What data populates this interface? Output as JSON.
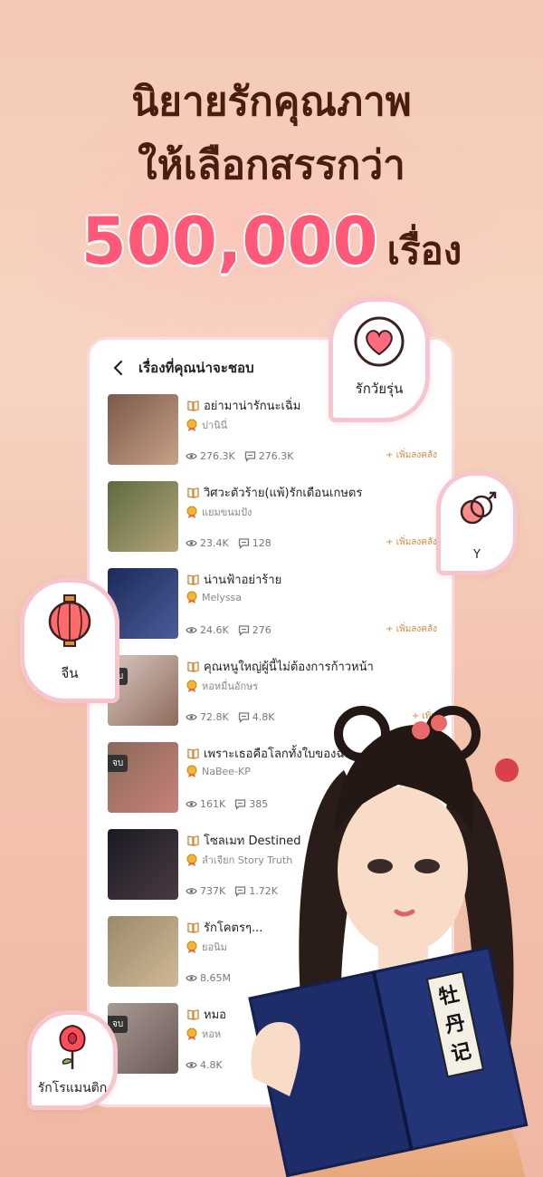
{
  "headline": {
    "line1": "นิยายรักคุณภาพ",
    "line2": "ให้เลือกสรรกว่า",
    "count": "500,000",
    "unit": "เรื่อง"
  },
  "screen": {
    "title": "เรื่องที่คุณน่าจะชอบ",
    "books": [
      {
        "title": "อย่ามาน่ารักนะเฉิ่ม",
        "author": "ปานินี่",
        "views": "276.3K",
        "comments": "276.3K",
        "add": "+ เพิ่มลงคลัง",
        "tag": "",
        "colors": [
          "#7a5a4a",
          "#c9a088"
        ]
      },
      {
        "title": "วิศวะตัวร้าย(แพ้)รักเดือนเกษตร",
        "author": "แยมขนมปัง",
        "views": "23.4K",
        "comments": "128",
        "add": "+ เพิ่มลงคลัง",
        "tag": "",
        "colors": [
          "#5d6b3e",
          "#b5a47a"
        ]
      },
      {
        "title": "น่านฟ้าอย่าร้าย",
        "author": "Melyssa",
        "views": "24.6K",
        "comments": "276",
        "add": "+ เพิ่มลงคลัง",
        "tag": "",
        "colors": [
          "#1c2a5a",
          "#4a5c9a"
        ]
      },
      {
        "title": "คุณหนูใหญ่ผู้นี้ไม่ต้องการก้าวหน้า",
        "author": "หอหมื่นอักษร",
        "views": "72.8K",
        "comments": "4.8K",
        "add": "+ เพิ่ม",
        "tag": "จบ",
        "colors": [
          "#d8c8c0",
          "#8e6a5c"
        ]
      },
      {
        "title": "เพราะเธอคือโลกทั้งใบของฉัน",
        "author": "NaBee-KP",
        "views": "161K",
        "comments": "385",
        "add": "",
        "tag": "จบ",
        "colors": [
          "#8a6a5a",
          "#c98078"
        ]
      },
      {
        "title": "โซลเมท Destined",
        "author": "ลำเจียก Story Truth",
        "views": "737K",
        "comments": "1.72K",
        "add": "",
        "tag": "",
        "colors": [
          "#1a1a22",
          "#4a3a44"
        ]
      },
      {
        "title": "รักโคตรๆ...",
        "author": "ยอนิม",
        "views": "8.65M",
        "comments": "",
        "add": "",
        "tag": "",
        "colors": [
          "#9a8a6a",
          "#d0b896"
        ]
      },
      {
        "title": "หมอ",
        "author": "หอห",
        "views": "4.8K",
        "comments": "",
        "add": "",
        "tag": "จบ",
        "colors": [
          "#a89a94",
          "#6a5a56"
        ]
      }
    ]
  },
  "bubbles": {
    "teen": "รักวัยรุ่น",
    "y": "Y",
    "chinese": "จีน",
    "romantic": "รักโรแมนติก"
  },
  "book_prop": {
    "title_chars": "牡丹记"
  },
  "colors": {
    "accent": "#ff5878",
    "gold": "#d28a3d"
  }
}
